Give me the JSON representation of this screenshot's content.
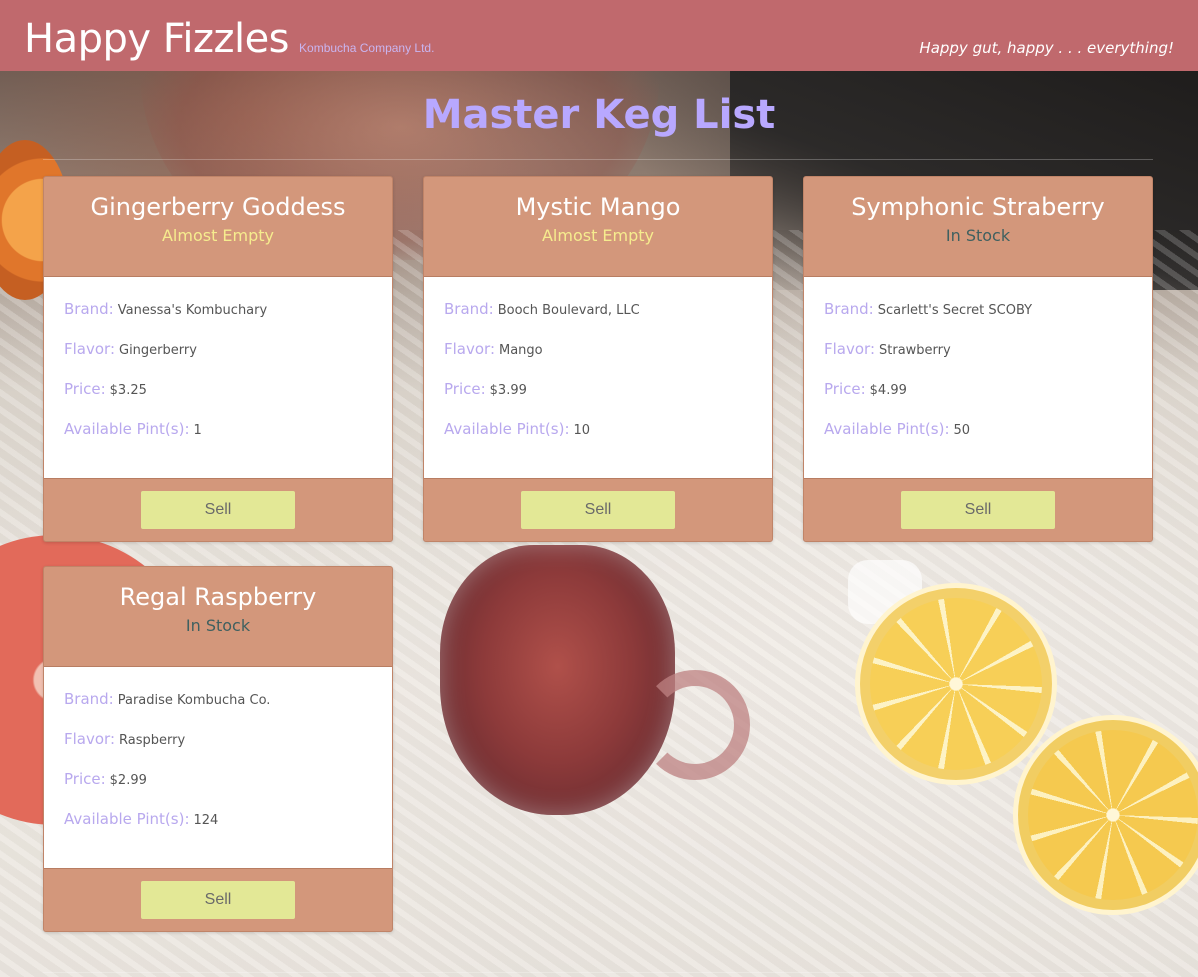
{
  "header": {
    "title": "Happy Fizzles",
    "subtitle": "Kombucha Company Ltd.",
    "tagline": "Happy gut, happy . . . everything!"
  },
  "page": {
    "title": "Master Keg List"
  },
  "labels": {
    "brand": "Brand:",
    "flavor": "Flavor:",
    "price": "Price:",
    "pints": "Available Pint(s):",
    "sell": "Sell"
  },
  "kegs": [
    {
      "name": "Gingerberry Goddess",
      "status": "Almost Empty",
      "brand": "Vanessa's Kombuchary",
      "flavor": "Gingerberry",
      "price": "$3.25",
      "pints": "1"
    },
    {
      "name": "Mystic Mango",
      "status": "Almost Empty",
      "brand": "Booch Boulevard, LLC",
      "flavor": "Mango",
      "price": "$3.99",
      "pints": "10"
    },
    {
      "name": "Symphonic Straberry",
      "status": "In Stock",
      "brand": "Scarlett's Secret SCOBY",
      "flavor": "Strawberry",
      "price": "$4.99",
      "pints": "50"
    },
    {
      "name": "Regal Raspberry",
      "status": "In Stock",
      "brand": "Paradise Kombucha Co.",
      "flavor": "Raspberry",
      "price": "$2.99",
      "pints": "124"
    }
  ],
  "colors": {
    "header_bg": "#c0696d",
    "title_color": "#b8a8ff",
    "card_bg": "#d3977b",
    "almost_empty": "#f6ec8e",
    "in_stock": "#3f6060",
    "sell_button": "#e3e896"
  }
}
